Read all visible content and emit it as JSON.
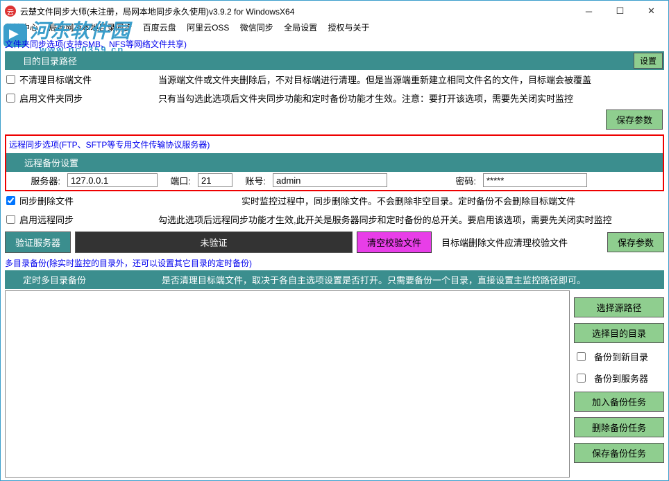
{
  "window": {
    "title": "云楚文件同步大师(未注册，局网本地同步永久使用)v3.9.2 for WindowsX64"
  },
  "menu": {
    "m1": "监控中心",
    "m2": "局域网及本地目录同步",
    "m3": "百度云盘",
    "m4": "阿里云OSS",
    "m5": "微信同步",
    "m6": "全局设置",
    "m7": "授权与关于"
  },
  "watermark": {
    "main": "河东软件园",
    "sub": "www.pc0359.cn"
  },
  "link1": "文件夹同步选项(支持SMB、NFS等网络文件共享)",
  "sec1": {
    "title": "目的目录路径",
    "setBtn": "设置"
  },
  "rowA": {
    "label": "不清理目标端文件",
    "desc": "当源端文件或文件夹删除后，不对目标端进行清理。但是当源端重新建立相同文件名的文件，目标端会被覆盖"
  },
  "rowB": {
    "label": "启用文件夹同步",
    "desc": "只有当勾选此选项后文件夹同步功能和定时备份功能才生效。注意：要打开该选项，需要先关闭实时监控"
  },
  "save": "保存参数",
  "link2": "远程同步选项(FTP、SFTP等专用文件传输协议服务器)",
  "sec2": {
    "title": "远程备份设置"
  },
  "form": {
    "serverLbl": "服务器:",
    "server": "127.0.0.1",
    "portLbl": "端口:",
    "port": "21",
    "acctLbl": "账号:",
    "acct": "admin",
    "pwdLbl": "密码:",
    "pwd": "*****"
  },
  "rowC": {
    "label": "同步删除文件",
    "desc": "实时监控过程中，同步删除文件。不会删除非空目录。定时备份不会删除目标端文件"
  },
  "rowD": {
    "label": "启用远程同步",
    "desc": "勾选此选项后远程同步功能才生效,此开关是服务器同步和定时备份的总开关。要启用该选项，需要先关闭实时监控"
  },
  "mid": {
    "verify": "验证服务器",
    "unverified": "未验证",
    "clear": "清空校验文件",
    "note": "目标端删除文件应清理校验文件"
  },
  "link3": "多目录备份(除实时监控的目录外，还可以设置其它目录的定时备份)",
  "sec3": {
    "title": "定时多目录备份",
    "desc": "是否清理目标端文件，取决于各自主选项设置是否打开。只需要备份一个目录，直接设置主监控路径即可。"
  },
  "side": {
    "b1": "选择源路径",
    "b2": "选择目的目录",
    "c1": "备份到新目录",
    "c2": "备份到服务器",
    "b3": "加入备份任务",
    "b4": "删除备份任务",
    "b5": "保存备份任务"
  }
}
